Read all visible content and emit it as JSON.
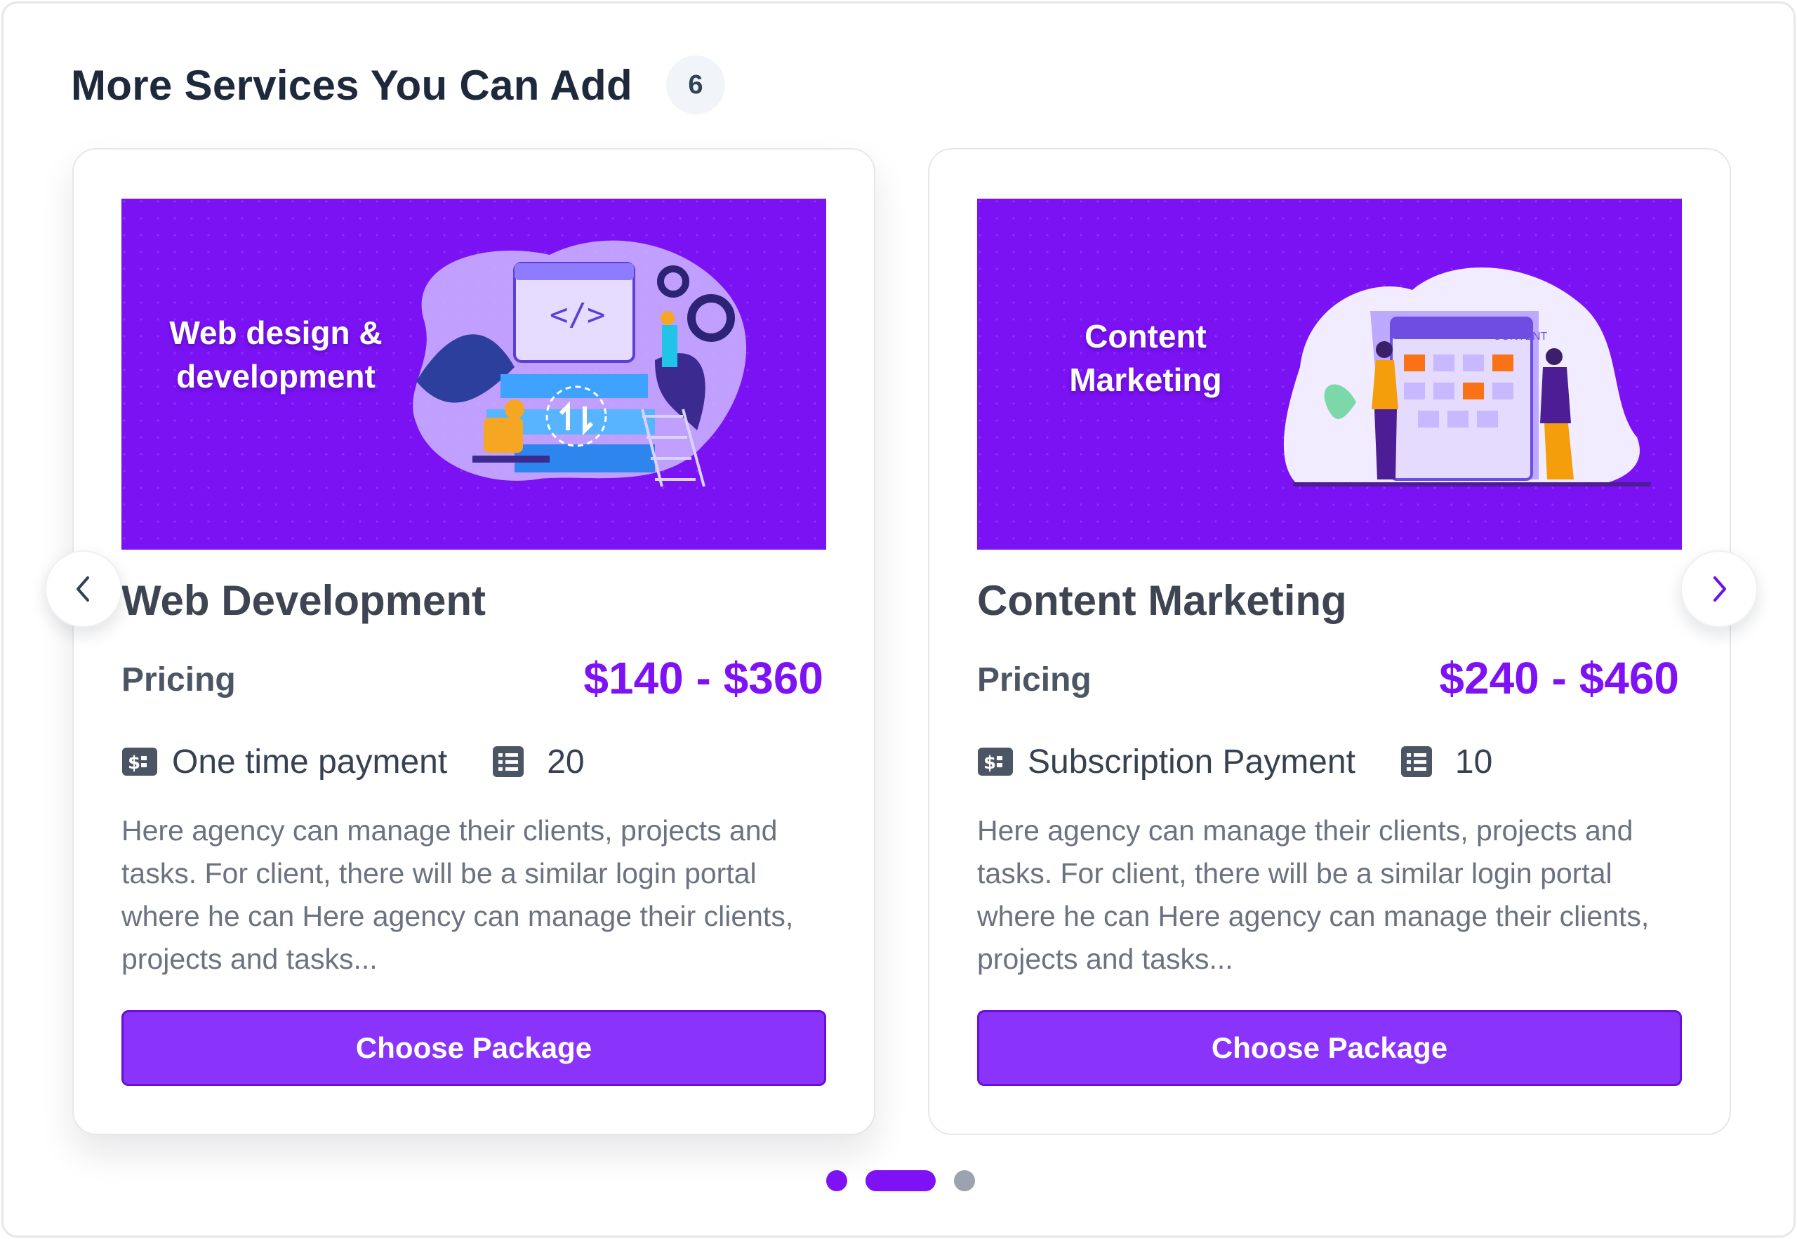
{
  "header": {
    "title": "More Services You Can Add",
    "count": "6"
  },
  "colors": {
    "accent": "#7e12f5",
    "button": "#8a34fb",
    "banner": "#7a12f4",
    "title": "#1e293b",
    "muted": "#6b7280"
  },
  "services": [
    {
      "banner_line1": "Web design &",
      "banner_line2": "development",
      "title": "Web Development",
      "pricing_label": "Pricing",
      "price_range": "$140 - $360",
      "payment_icon": "payment-card-icon",
      "payment_type": "One time payment",
      "quantity_icon": "list-icon",
      "quantity": "20",
      "description": "Here agency can manage their clients, projects and tasks. For client, there will be a similar login portal where he can Here agency can manage their clients, projects and tasks...",
      "button_label": "Choose Package"
    },
    {
      "banner_line1": "Content",
      "banner_line2": "Marketing",
      "banner_board_label": "CONTENT",
      "title": "Content Marketing",
      "pricing_label": "Pricing",
      "price_range": "$240 - $460",
      "payment_icon": "payment-card-icon",
      "payment_type": "Subscription Payment",
      "quantity_icon": "list-icon",
      "quantity": "10",
      "description": "Here agency can manage their clients, projects and tasks. For client, there will be a similar login portal where he can Here agency can manage their clients, projects and tasks...",
      "button_label": "Choose Package"
    }
  ],
  "carousel": {
    "prev_icon": "chevron-left-icon",
    "next_icon": "chevron-right-icon",
    "pages": 3,
    "active_page": 2
  }
}
